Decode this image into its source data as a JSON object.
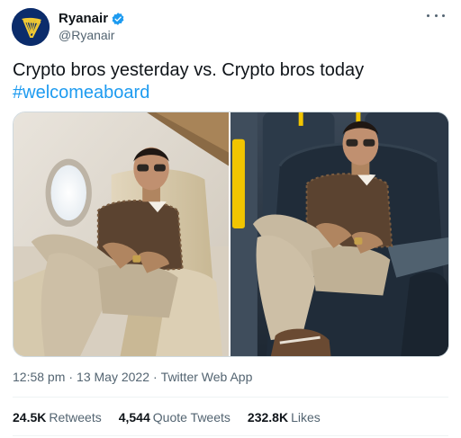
{
  "account": {
    "name": "Ryanair",
    "handle": "@Ryanair",
    "verified": true,
    "avatar_icon": "ryanair-harp-logo-icon",
    "brand_color": "#0b2c6b",
    "logo_accent": "#f1c933"
  },
  "menu": {
    "icon": "more-horizontal-icon"
  },
  "tweet": {
    "text": "Crypto bros yesterday vs. Crypto bros today",
    "hashtag": "#welcomeaboard",
    "hashtag_color": "#1d9bf0"
  },
  "media": {
    "photos": [
      {
        "name": "private-jet-photo",
        "scene": "man seated in cream leather private jet seat"
      },
      {
        "name": "economy-cabin-photo",
        "scene": "man seated in navy Ryanair economy seat"
      }
    ]
  },
  "meta": {
    "time": "12:58 pm",
    "separator": "·",
    "date": "13 May 2022",
    "source": "Twitter Web App"
  },
  "stats": {
    "retweets": {
      "value": "24.5K",
      "label": "Retweets"
    },
    "quotes": {
      "value": "4,544",
      "label": "Quote Tweets"
    },
    "likes": {
      "value": "232.8K",
      "label": "Likes"
    }
  }
}
